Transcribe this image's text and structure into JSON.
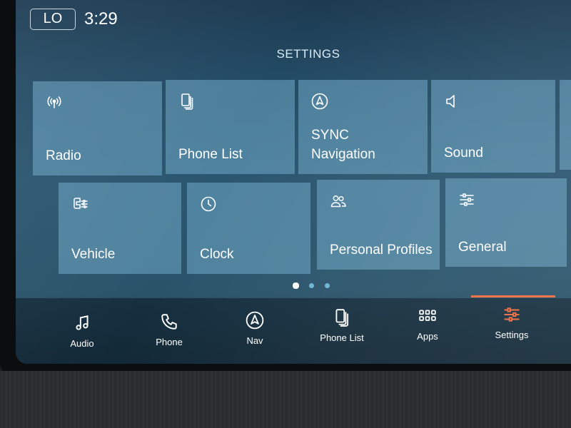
{
  "status": {
    "climate_badge": "LO",
    "time": "3:29"
  },
  "title": "SETTINGS",
  "tiles": [
    {
      "icon": "radio-icon",
      "label": "Radio"
    },
    {
      "icon": "phone-list-icon",
      "label": "Phone List"
    },
    {
      "icon": "navigation-icon",
      "label_line1": "SYNC",
      "label_line2": "Navigation"
    },
    {
      "icon": "sound-icon",
      "label": "Sound"
    },
    {
      "icon": "vehicle-icon",
      "label": "Vehicle"
    },
    {
      "icon": "clock-icon",
      "label": "Clock"
    },
    {
      "icon": "personal-profiles-icon",
      "label": "Personal Profiles"
    },
    {
      "icon": "sliders-icon",
      "label": "General"
    }
  ],
  "pagination": {
    "pages": 3,
    "current": 1
  },
  "nav": [
    {
      "icon": "music-note-icon",
      "label": "Audio"
    },
    {
      "icon": "phone-icon",
      "label": "Phone"
    },
    {
      "icon": "navigation-icon",
      "label": "Nav"
    },
    {
      "icon": "phone-list-icon",
      "label": "Phone List"
    },
    {
      "icon": "apps-grid-icon",
      "label": "Apps"
    },
    {
      "icon": "settings-sliders-icon",
      "label": "Settings",
      "active": true
    }
  ],
  "colors": {
    "active_accent": "#f06a3d",
    "tile": "#5f9ab8",
    "screen": "#2b5670"
  }
}
